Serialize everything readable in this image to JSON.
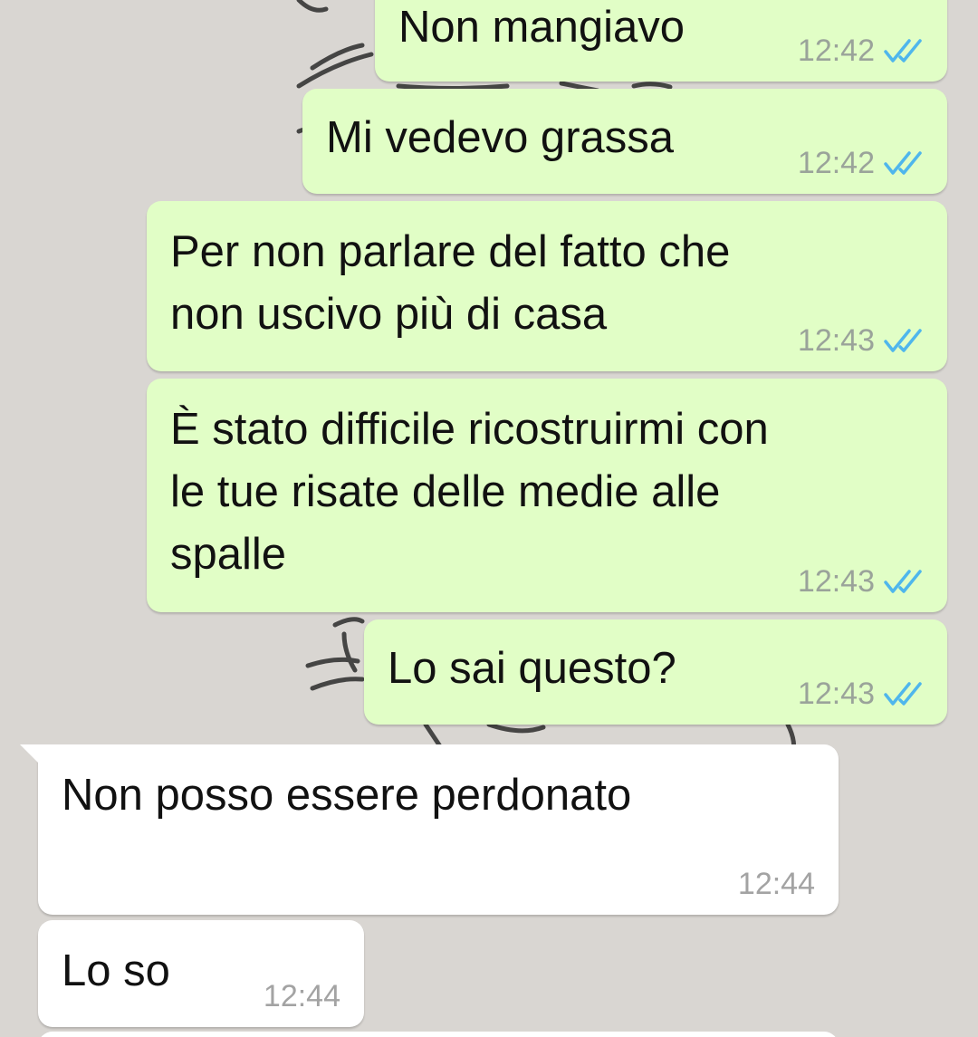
{
  "colors": {
    "background": "#d9d6d2",
    "outgoing_bubble": "#e1fec6",
    "incoming_bubble": "#ffffff",
    "read_ticks": "#4fb6ec"
  },
  "messages": [
    {
      "direction": "outgoing",
      "text": "Non mangiavo",
      "time": "12:42",
      "status": "read-double-check-icon"
    },
    {
      "direction": "outgoing",
      "text": "Mi vedevo grassa",
      "time": "12:42",
      "status": "read-double-check-icon"
    },
    {
      "direction": "outgoing",
      "text": "Per non parlare del fatto che\nnon uscivo più di casa",
      "time": "12:43",
      "status": "read-double-check-icon"
    },
    {
      "direction": "outgoing",
      "text": "È stato difficile ricostruirmi con\nle tue risate delle medie alle\nspalle",
      "time": "12:43",
      "status": "read-double-check-icon"
    },
    {
      "direction": "outgoing",
      "text": "Lo sai questo?",
      "time": "12:43",
      "status": "read-double-check-icon"
    },
    {
      "direction": "incoming",
      "text": "Non posso essere perdonato",
      "time": "12:44"
    },
    {
      "direction": "incoming",
      "text": "Lo so",
      "time": "12:44"
    }
  ]
}
